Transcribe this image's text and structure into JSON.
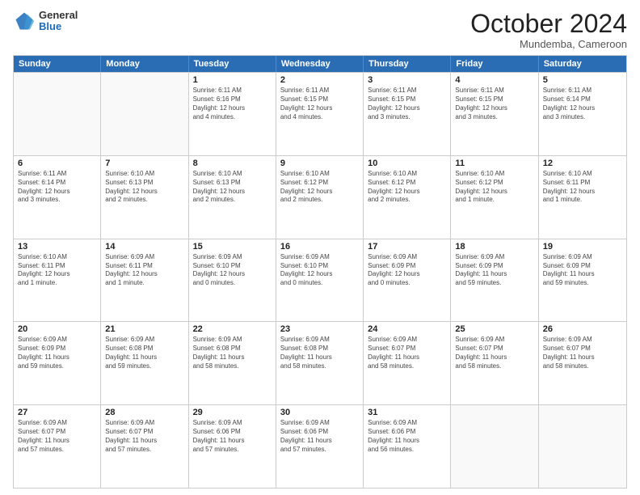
{
  "logo": {
    "general": "General",
    "blue": "Blue"
  },
  "header": {
    "month": "October 2024",
    "location": "Mundemba, Cameroon"
  },
  "days": [
    "Sunday",
    "Monday",
    "Tuesday",
    "Wednesday",
    "Thursday",
    "Friday",
    "Saturday"
  ],
  "rows": [
    [
      {
        "day": "",
        "info": "",
        "empty": true
      },
      {
        "day": "",
        "info": "",
        "empty": true
      },
      {
        "day": "1",
        "info": "Sunrise: 6:11 AM\nSunset: 6:16 PM\nDaylight: 12 hours\nand 4 minutes."
      },
      {
        "day": "2",
        "info": "Sunrise: 6:11 AM\nSunset: 6:15 PM\nDaylight: 12 hours\nand 4 minutes."
      },
      {
        "day": "3",
        "info": "Sunrise: 6:11 AM\nSunset: 6:15 PM\nDaylight: 12 hours\nand 3 minutes."
      },
      {
        "day": "4",
        "info": "Sunrise: 6:11 AM\nSunset: 6:15 PM\nDaylight: 12 hours\nand 3 minutes."
      },
      {
        "day": "5",
        "info": "Sunrise: 6:11 AM\nSunset: 6:14 PM\nDaylight: 12 hours\nand 3 minutes."
      }
    ],
    [
      {
        "day": "6",
        "info": "Sunrise: 6:11 AM\nSunset: 6:14 PM\nDaylight: 12 hours\nand 3 minutes."
      },
      {
        "day": "7",
        "info": "Sunrise: 6:10 AM\nSunset: 6:13 PM\nDaylight: 12 hours\nand 2 minutes."
      },
      {
        "day": "8",
        "info": "Sunrise: 6:10 AM\nSunset: 6:13 PM\nDaylight: 12 hours\nand 2 minutes."
      },
      {
        "day": "9",
        "info": "Sunrise: 6:10 AM\nSunset: 6:12 PM\nDaylight: 12 hours\nand 2 minutes."
      },
      {
        "day": "10",
        "info": "Sunrise: 6:10 AM\nSunset: 6:12 PM\nDaylight: 12 hours\nand 2 minutes."
      },
      {
        "day": "11",
        "info": "Sunrise: 6:10 AM\nSunset: 6:12 PM\nDaylight: 12 hours\nand 1 minute."
      },
      {
        "day": "12",
        "info": "Sunrise: 6:10 AM\nSunset: 6:11 PM\nDaylight: 12 hours\nand 1 minute."
      }
    ],
    [
      {
        "day": "13",
        "info": "Sunrise: 6:10 AM\nSunset: 6:11 PM\nDaylight: 12 hours\nand 1 minute."
      },
      {
        "day": "14",
        "info": "Sunrise: 6:09 AM\nSunset: 6:11 PM\nDaylight: 12 hours\nand 1 minute."
      },
      {
        "day": "15",
        "info": "Sunrise: 6:09 AM\nSunset: 6:10 PM\nDaylight: 12 hours\nand 0 minutes."
      },
      {
        "day": "16",
        "info": "Sunrise: 6:09 AM\nSunset: 6:10 PM\nDaylight: 12 hours\nand 0 minutes."
      },
      {
        "day": "17",
        "info": "Sunrise: 6:09 AM\nSunset: 6:09 PM\nDaylight: 12 hours\nand 0 minutes."
      },
      {
        "day": "18",
        "info": "Sunrise: 6:09 AM\nSunset: 6:09 PM\nDaylight: 11 hours\nand 59 minutes."
      },
      {
        "day": "19",
        "info": "Sunrise: 6:09 AM\nSunset: 6:09 PM\nDaylight: 11 hours\nand 59 minutes."
      }
    ],
    [
      {
        "day": "20",
        "info": "Sunrise: 6:09 AM\nSunset: 6:09 PM\nDaylight: 11 hours\nand 59 minutes."
      },
      {
        "day": "21",
        "info": "Sunrise: 6:09 AM\nSunset: 6:08 PM\nDaylight: 11 hours\nand 59 minutes."
      },
      {
        "day": "22",
        "info": "Sunrise: 6:09 AM\nSunset: 6:08 PM\nDaylight: 11 hours\nand 58 minutes."
      },
      {
        "day": "23",
        "info": "Sunrise: 6:09 AM\nSunset: 6:08 PM\nDaylight: 11 hours\nand 58 minutes."
      },
      {
        "day": "24",
        "info": "Sunrise: 6:09 AM\nSunset: 6:07 PM\nDaylight: 11 hours\nand 58 minutes."
      },
      {
        "day": "25",
        "info": "Sunrise: 6:09 AM\nSunset: 6:07 PM\nDaylight: 11 hours\nand 58 minutes."
      },
      {
        "day": "26",
        "info": "Sunrise: 6:09 AM\nSunset: 6:07 PM\nDaylight: 11 hours\nand 58 minutes."
      }
    ],
    [
      {
        "day": "27",
        "info": "Sunrise: 6:09 AM\nSunset: 6:07 PM\nDaylight: 11 hours\nand 57 minutes."
      },
      {
        "day": "28",
        "info": "Sunrise: 6:09 AM\nSunset: 6:07 PM\nDaylight: 11 hours\nand 57 minutes."
      },
      {
        "day": "29",
        "info": "Sunrise: 6:09 AM\nSunset: 6:06 PM\nDaylight: 11 hours\nand 57 minutes."
      },
      {
        "day": "30",
        "info": "Sunrise: 6:09 AM\nSunset: 6:06 PM\nDaylight: 11 hours\nand 57 minutes."
      },
      {
        "day": "31",
        "info": "Sunrise: 6:09 AM\nSunset: 6:06 PM\nDaylight: 11 hours\nand 56 minutes."
      },
      {
        "day": "",
        "info": "",
        "empty": true
      },
      {
        "day": "",
        "info": "",
        "empty": true
      }
    ]
  ]
}
